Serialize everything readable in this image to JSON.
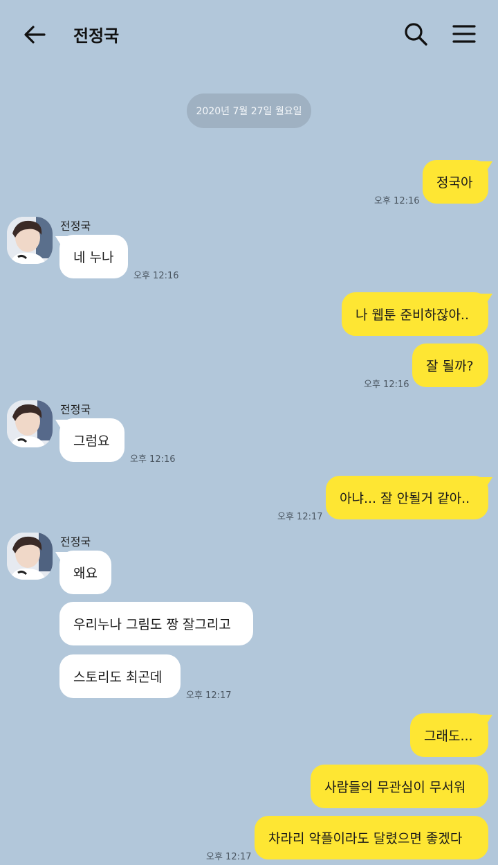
{
  "header": {
    "title": "전정국"
  },
  "date_divider": "2020년 7월 27일 월요일",
  "sender_name": "전정국",
  "messages": {
    "m1": {
      "text": "정국아",
      "time": "오후 12:16"
    },
    "m2": {
      "text": "네 누나",
      "time": "오후 12:16"
    },
    "m3": {
      "text": "나 웹툰 준비하잖아.."
    },
    "m4": {
      "text": "잘 될까?",
      "time": "오후 12:16"
    },
    "m5": {
      "text": "그럼요",
      "time": "오후 12:16"
    },
    "m6": {
      "text": "아냐... 잘 안될거 같아..",
      "time": "오후 12:17"
    },
    "m7": {
      "text": "왜요"
    },
    "m8": {
      "text": "우리누나 그림도 짱 잘그리고"
    },
    "m9": {
      "text": "스토리도 최곤데",
      "time": "오후 12:17"
    },
    "m10": {
      "text": "그래도..."
    },
    "m11": {
      "text": "사람들의 무관심이 무서워"
    },
    "m12": {
      "text": "차라리 악플이라도 달렸으면 좋겠다",
      "time": "오후 12:17"
    }
  },
  "colors": {
    "background": "#b2c7da",
    "my_bubble": "#fee633",
    "their_bubble": "#ffffff",
    "date_pill": "#9fb1c2"
  },
  "icons": [
    "back-arrow-icon",
    "search-icon",
    "menu-icon"
  ]
}
